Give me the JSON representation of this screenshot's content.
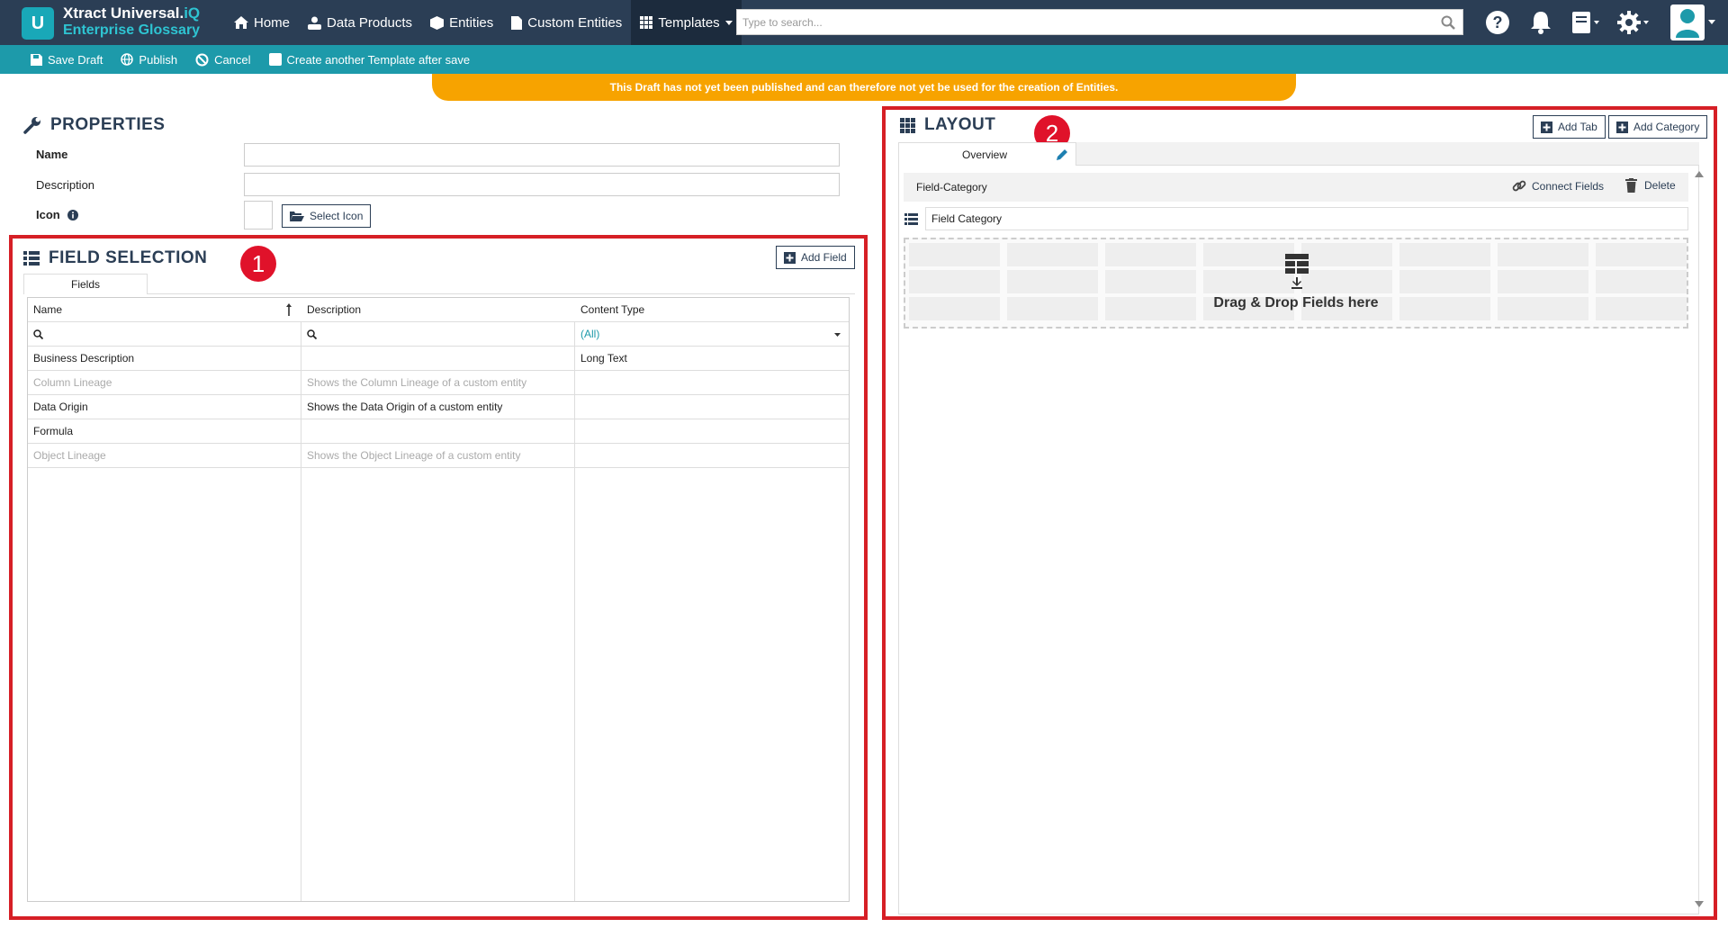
{
  "app": {
    "logo_letter": "U",
    "title_main": "Xtract Universal.",
    "title_suffix": "iQ",
    "subtitle": "Enterprise Glossary"
  },
  "nav": {
    "items": [
      {
        "label": "Home",
        "icon": "home-icon"
      },
      {
        "label": "Data Products",
        "icon": "data-products-icon"
      },
      {
        "label": "Entities",
        "icon": "cube-icon"
      },
      {
        "label": "Custom Entities",
        "icon": "document-icon"
      },
      {
        "label": "Templates",
        "icon": "grid-icon",
        "active": true
      }
    ]
  },
  "search": {
    "placeholder": "Type to search..."
  },
  "toolbar": {
    "save_draft": "Save Draft",
    "publish": "Publish",
    "cancel": "Cancel",
    "create_another": "Create another Template after save"
  },
  "banner": {
    "text": "This Draft has not yet been published and can therefore not yet be used for the creation of Entities."
  },
  "properties": {
    "heading": "PROPERTIES",
    "name_label": "Name",
    "name_value": "",
    "description_label": "Description",
    "description_value": "",
    "icon_label": "Icon",
    "select_icon": "Select Icon"
  },
  "field_selection": {
    "heading": "FIELD SELECTION",
    "badge": "1",
    "add_field": "Add Field",
    "tab": "Fields",
    "columns": [
      "Name",
      "Description",
      "Content Type"
    ],
    "content_type_filter": "(All)",
    "rows": [
      {
        "name": "Business Description",
        "description": "",
        "content_type": "Long Text",
        "muted": false
      },
      {
        "name": "Column Lineage",
        "description": "Shows the Column Lineage of a custom entity",
        "content_type": "",
        "muted": true
      },
      {
        "name": "Data Origin",
        "description": "Shows the Data Origin of a custom entity",
        "content_type": "",
        "muted": false
      },
      {
        "name": "Formula",
        "description": "",
        "content_type": "",
        "muted": false
      },
      {
        "name": "Object Lineage",
        "description": "Shows the Object Lineage of a custom entity",
        "content_type": "",
        "muted": true
      }
    ]
  },
  "layout": {
    "heading": "LAYOUT",
    "badge": "2",
    "add_tab": "Add Tab",
    "add_category": "Add Category",
    "tab": "Overview",
    "category_title": "Field-Category",
    "connect_fields": "Connect Fields",
    "delete": "Delete",
    "category_name": "Field Category",
    "drop_text": "Drag & Drop Fields here"
  },
  "colors": {
    "navbar": "#2b3e55",
    "toolbar": "#1d9aaa",
    "banner": "#f7a300",
    "highlight": "#d61f26",
    "badge": "#e0122a",
    "accent": "#2ec4d2"
  }
}
